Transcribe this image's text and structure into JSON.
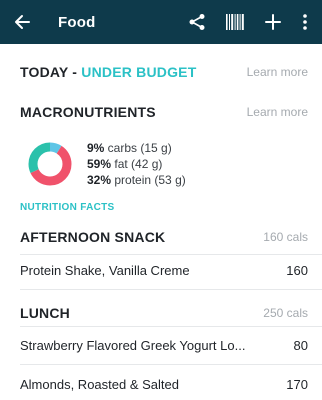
{
  "appbar": {
    "title": "Food",
    "icons": [
      "back-arrow-icon",
      "share-icon",
      "barcode-icon",
      "plus-icon",
      "more-vert-icon"
    ]
  },
  "today": {
    "label": "TODAY - ",
    "status": "UNDER BUDGET",
    "link": "Learn more"
  },
  "macros": {
    "title": "MACRONUTRIENTS",
    "link": "Learn more",
    "items": [
      {
        "pct": "9%",
        "text": " carbs (15 g)",
        "value": 9,
        "color": "#5ec5e6"
      },
      {
        "pct": "59%",
        "text": " fat (42 g)",
        "value": 59,
        "color": "#f0526b"
      },
      {
        "pct": "32%",
        "text": " protein (53 g)",
        "value": 32,
        "color": "#2bc1ab"
      }
    ]
  },
  "nutrition_facts": "NUTRITION FACTS",
  "meals": [
    {
      "name": "AFTERNOON SNACK",
      "cals": "160 cals",
      "items": [
        {
          "name": "Protein Shake, Vanilla Creme",
          "cal": "160"
        }
      ]
    },
    {
      "name": "LUNCH",
      "cals": "250 cals",
      "items": [
        {
          "name": "Strawberry Flavored Greek Yogurt Lo...",
          "cal": "80"
        },
        {
          "name": "Almonds, Roasted & Salted",
          "cal": "170"
        }
      ]
    }
  ],
  "colors": {
    "appbar": "#0e3a4b",
    "accent": "#2bc1c6"
  }
}
